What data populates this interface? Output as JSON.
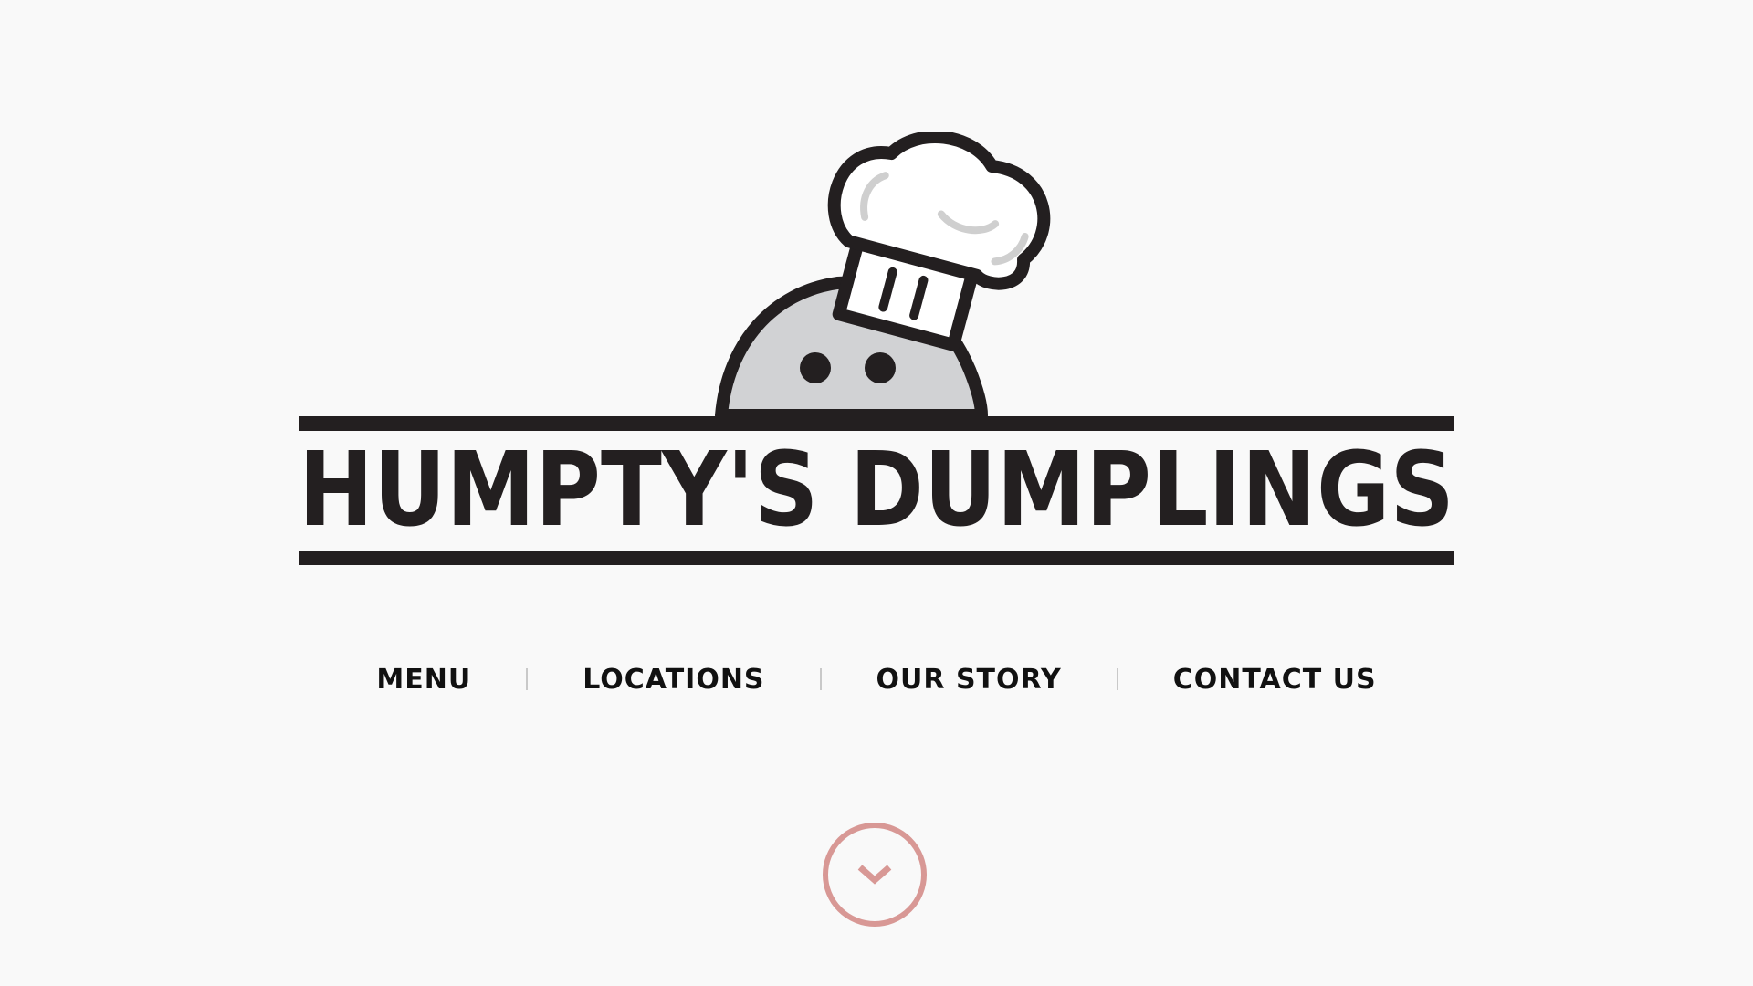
{
  "brand": {
    "wordmark": "HUMPTY'S DUMPLINGS",
    "mascot_icon": "chef-dumpling-icon",
    "ink_color": "#231f20",
    "dumpling_color": "#d1d2d4"
  },
  "nav": {
    "items": [
      {
        "label": "MENU"
      },
      {
        "label": "LOCATIONS"
      },
      {
        "label": "OUR STORY"
      },
      {
        "label": "CONTACT US"
      }
    ]
  },
  "scroll_down": {
    "icon": "chevron-down-icon",
    "color": "#d89895"
  },
  "colors": {
    "background": "#f9f9f9",
    "nav_text": "#111111",
    "separator": "#c9c9c9"
  }
}
